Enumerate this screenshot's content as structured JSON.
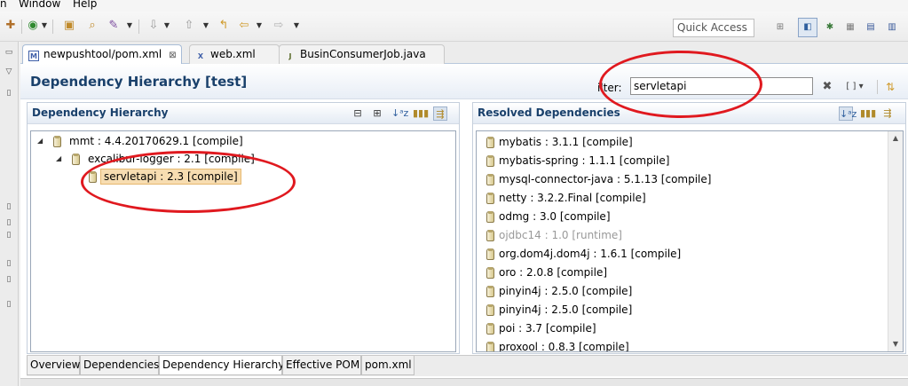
{
  "menu": {
    "items": [
      "n",
      "Window",
      "Help"
    ]
  },
  "toolbar": {
    "quick_access": "Quick Access",
    "icons": [
      "new-wizard-icon",
      "run-icon",
      "open-type-icon",
      "search-icon",
      "external-tools-icon",
      "back-icon",
      "forward-icon"
    ]
  },
  "tabs": [
    {
      "label": "newpushtool/pom.xml",
      "icon": "M",
      "icon_color": "#3f5fa8",
      "active": true
    },
    {
      "label": "web.xml",
      "icon": "X",
      "icon_color": "#3f5fa8",
      "active": false
    },
    {
      "label": "BusinConsumerJob.java",
      "icon": "J",
      "icon_color": "#5b6b2a",
      "active": false
    }
  ],
  "form": {
    "title": "Dependency Hierarchy [test]",
    "filter_label": "ilter:",
    "filter_value": "servletapi",
    "clear_label": "✖",
    "menu_label": "[ ] ▾"
  },
  "hierarchy": {
    "title": "Dependency Hierarchy",
    "rows": [
      {
        "label": "mmt : 4.4.20170629.1 [compile]",
        "level": 0,
        "expanded": true,
        "selected": false
      },
      {
        "label": "excalibur-logger : 2.1 [compile]",
        "level": 1,
        "expanded": true,
        "selected": false
      },
      {
        "label": "servletapi : 2.3 [compile]",
        "level": 2,
        "expanded": false,
        "selected": true
      }
    ]
  },
  "resolved": {
    "title": "Resolved Dependencies",
    "rows": [
      {
        "label": "mybatis : 3.1.1 [compile]",
        "grey": false
      },
      {
        "label": "mybatis-spring : 1.1.1 [compile]",
        "grey": false
      },
      {
        "label": "mysql-connector-java : 5.1.13 [compile]",
        "grey": false
      },
      {
        "label": "netty : 3.2.2.Final [compile]",
        "grey": false
      },
      {
        "label": "odmg : 3.0 [compile]",
        "grey": false
      },
      {
        "label": "ojdbc14 : 1.0 [runtime]",
        "grey": true
      },
      {
        "label": "org.dom4j.dom4j : 1.6.1 [compile]",
        "grey": false
      },
      {
        "label": "oro : 2.0.8 [compile]",
        "grey": false
      },
      {
        "label": "pinyin4j : 2.5.0 [compile]",
        "grey": false
      },
      {
        "label": "pinyin4j : 2.5.0 [compile]",
        "grey": false
      },
      {
        "label": "poi : 3.7 [compile]",
        "grey": false
      },
      {
        "label": "proxool : 0.8.3 [compile]",
        "grey": false
      }
    ]
  },
  "page_tabs": [
    {
      "label": "Overview",
      "active": false
    },
    {
      "label": "Dependencies",
      "active": false
    },
    {
      "label": "Dependency Hierarchy",
      "active": true
    },
    {
      "label": "Effective POM",
      "active": false
    },
    {
      "label": "pom.xml",
      "active": false
    }
  ],
  "annotation_color": "#e0191f"
}
